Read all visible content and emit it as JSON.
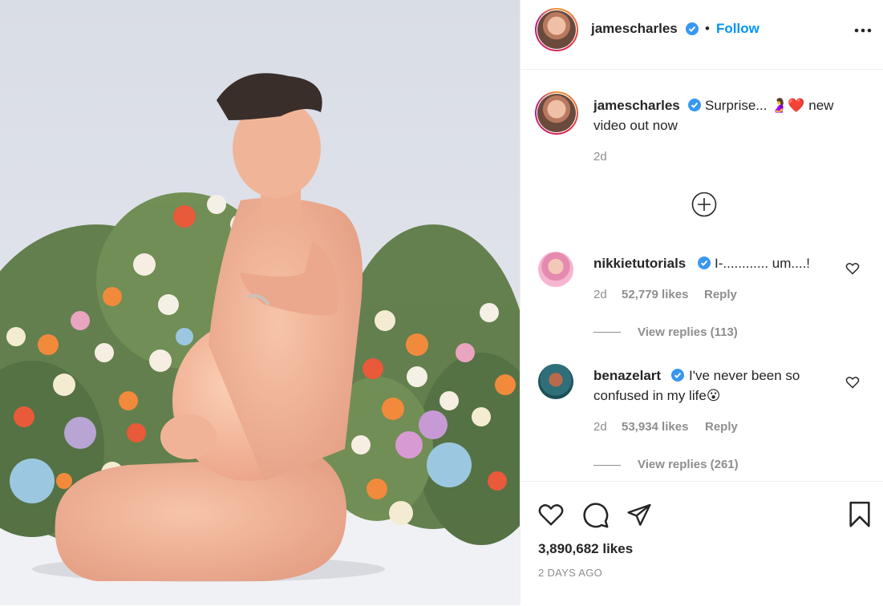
{
  "post": {
    "author": "jamescharles",
    "follow_dot": "•",
    "follow_label": "Follow",
    "more_icon": "more-horizontal-icon"
  },
  "caption": {
    "username": "jamescharles",
    "text_line1": "Surprise... 🤰❤️ new",
    "text_line2": "video out now",
    "time": "2d"
  },
  "load_more_icon": "plus-circle-icon",
  "comments": [
    {
      "username": "nikkietutorials",
      "text_line1": "I-............ um....!",
      "text_line2": "",
      "time": "2d",
      "likes": "52,779 likes",
      "reply": "Reply",
      "view_replies": "View replies (113)"
    },
    {
      "username": "benazelart",
      "text_line1": "I've never been so",
      "text_line2": "confused in my life😮",
      "time": "2d",
      "likes": "53,934 likes",
      "reply": "Reply",
      "view_replies": "View replies (261)"
    }
  ],
  "actions": {
    "like_icon": "heart-icon",
    "comment_icon": "comment-icon",
    "share_icon": "share-icon",
    "save_icon": "bookmark-icon"
  },
  "likes_total": "3,890,682 likes",
  "post_date": "2 DAYS AGO",
  "colors": {
    "link_blue": "#0095f6",
    "verified_blue": "#3897f0",
    "muted": "#8e8e8e",
    "text": "#262626"
  }
}
